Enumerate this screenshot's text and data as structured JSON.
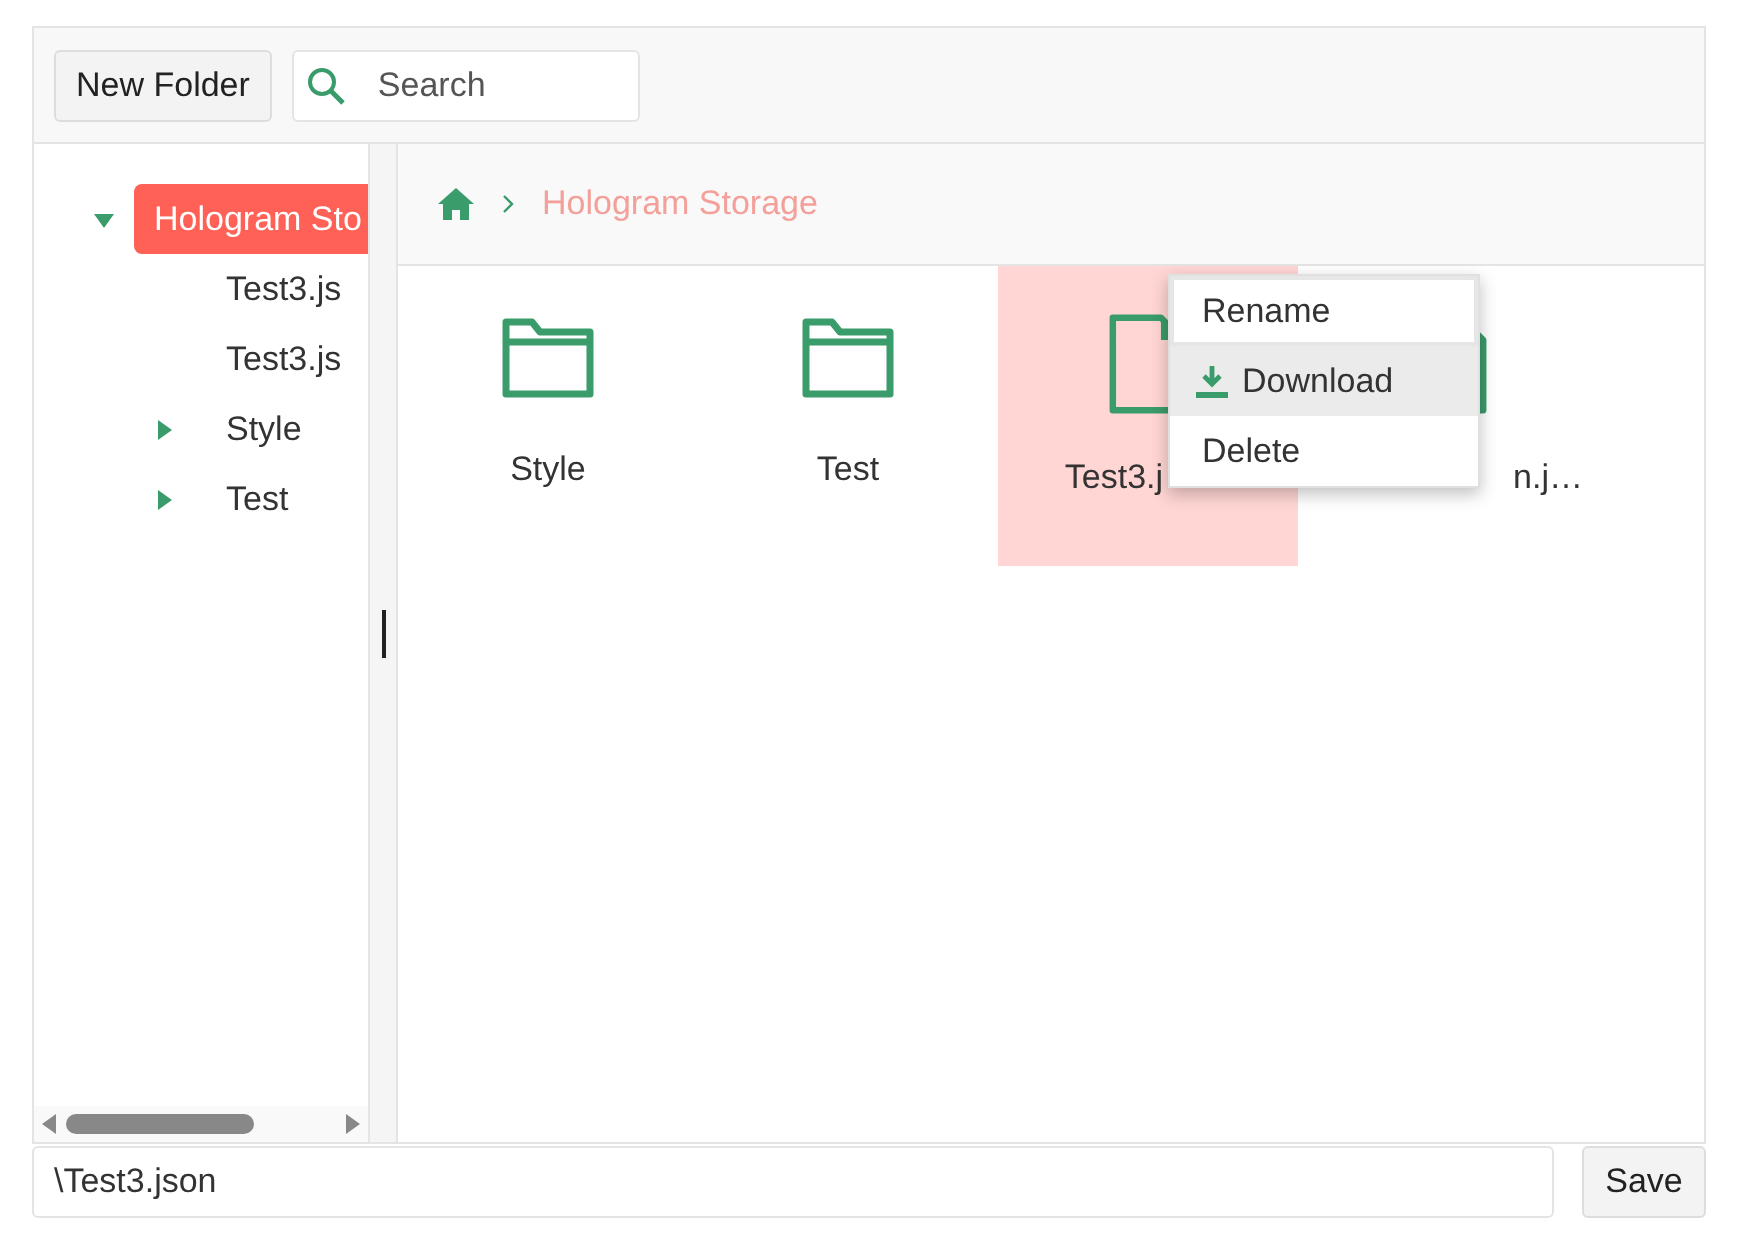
{
  "toolbar": {
    "new_folder": "New Folder",
    "search": {
      "placeholder": "Search"
    }
  },
  "tree": [
    {
      "label": "Hologram Sto",
      "selected": true,
      "expanded": true,
      "children": [
        {
          "label": "Test3.js",
          "selected": false
        },
        {
          "label": "Test3.js",
          "selected": false
        },
        {
          "label": "Style",
          "selected": false,
          "expanded": false
        },
        {
          "label": "Test",
          "selected": false,
          "expanded": false
        }
      ]
    }
  ],
  "breadcrumb": [
    "Hologram Storage"
  ],
  "files": [
    {
      "kind": "folder",
      "label": "Style",
      "selected": false
    },
    {
      "kind": "folder",
      "label": "Test",
      "selected": false
    },
    {
      "kind": "file",
      "label": "Test3.j",
      "selected": true
    },
    {
      "kind": "file",
      "label": "n.j…",
      "selected": false
    }
  ],
  "context_menu": [
    {
      "kind": "plain",
      "label": "Rename",
      "focused": true,
      "highlighted": false
    },
    {
      "kind": "download",
      "label": "Download",
      "focused": false,
      "highlighted": true
    },
    {
      "kind": "plain",
      "label": "Delete",
      "focused": false,
      "highlighted": false
    }
  ],
  "path_field": {
    "value": "\\Test3.json"
  },
  "save": "Save"
}
